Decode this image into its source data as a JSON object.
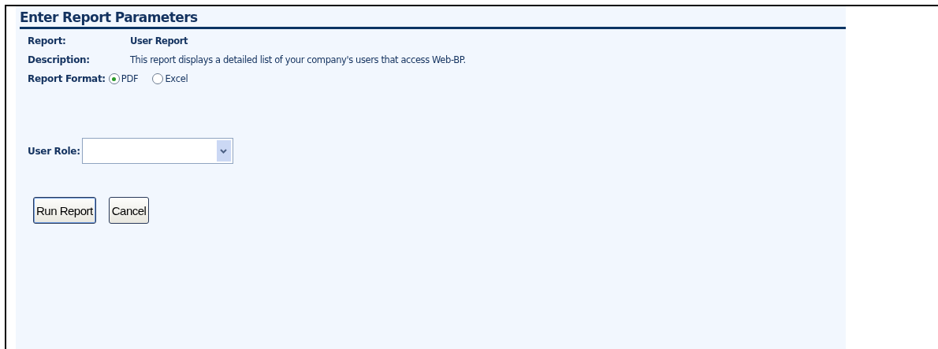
{
  "panel": {
    "title": "Enter Report Parameters"
  },
  "fields": [
    {
      "kind": "text",
      "label": "Report:",
      "value": "User Report",
      "bold": true
    },
    {
      "kind": "text",
      "label": "Description:",
      "value": "This report displays a detailed list of your company's users that access Web-BP.",
      "bold": false
    },
    {
      "kind": "radio",
      "label": "Report Format:",
      "options": [
        {
          "label": "PDF",
          "selected": true
        },
        {
          "label": "Excel",
          "selected": false
        }
      ]
    }
  ],
  "user_role": {
    "label": "User Role:"
  },
  "buttons": [
    {
      "label": "Run Report",
      "default": true
    },
    {
      "label": "Cancel",
      "default": false
    }
  ]
}
